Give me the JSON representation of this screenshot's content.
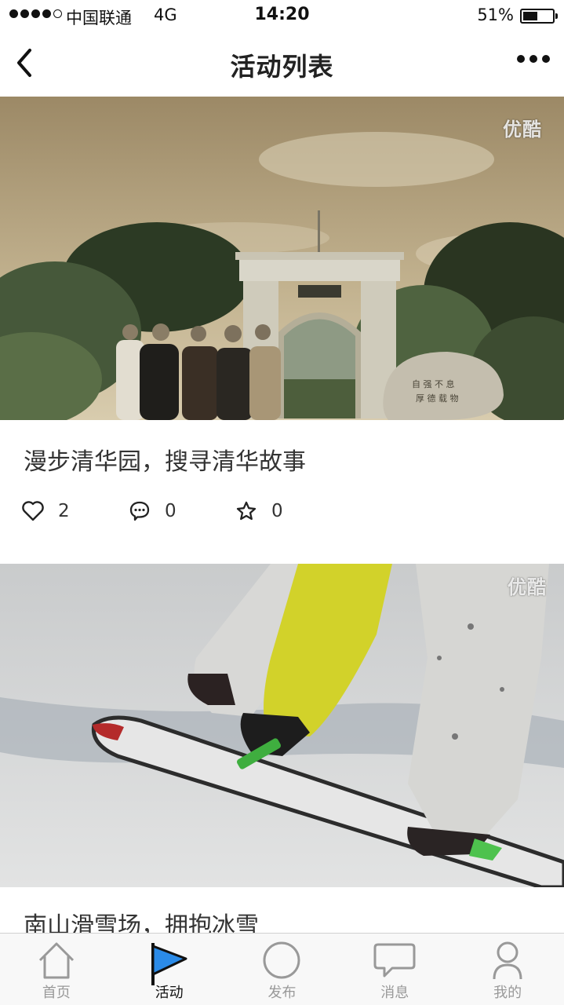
{
  "status_bar": {
    "carrier": "中国联通",
    "network": "4G",
    "time": "14:20",
    "battery": "51%",
    "battery_level": 0.51
  },
  "nav": {
    "title": "活动列表",
    "back_icon": "chevron-left-icon",
    "more_icon": "more-dots-icon"
  },
  "activities": [
    {
      "title": "漫步清华园，搜寻清华故事",
      "watermark": "优酷",
      "likes": "2",
      "comments": "0",
      "favorites": "0"
    },
    {
      "title": "南山滑雪场，拥抱冰雪",
      "watermark": "优酷"
    }
  ],
  "tabs": [
    {
      "label": "首页",
      "icon": "home-icon",
      "active": false
    },
    {
      "label": "活动",
      "icon": "activity-flag-icon",
      "active": true
    },
    {
      "label": "发布",
      "icon": "publish-circle-icon",
      "active": false
    },
    {
      "label": "消息",
      "icon": "message-bubble-icon",
      "active": false
    },
    {
      "label": "我的",
      "icon": "profile-icon",
      "active": false
    }
  ],
  "colors": {
    "accent": "#2b8be8",
    "tab_inactive": "#999999"
  }
}
